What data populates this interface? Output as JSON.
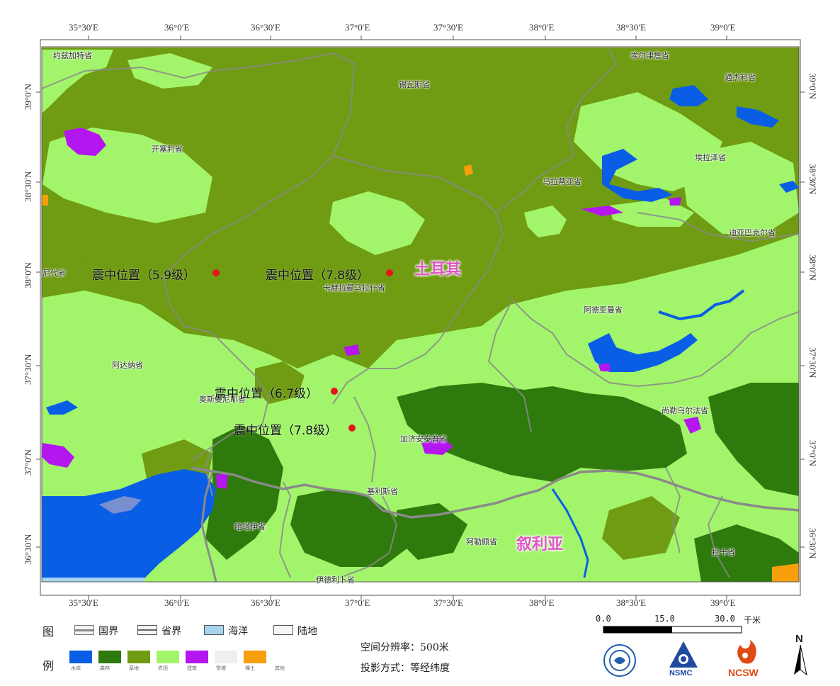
{
  "graticule": {
    "top_labels": [
      "35°30′E",
      "36°0′E",
      "36°30′E",
      "37°0′E",
      "37°30′E",
      "38°0′E",
      "38°30′E",
      "39°0′E"
    ],
    "bottom_labels": [
      "35°30′E",
      "36°0′E",
      "36°30′E",
      "37°0′E",
      "37°30′E",
      "38°0′E",
      "38°30′E",
      "39°0′E"
    ],
    "left_labels": [
      "39°0′N",
      "38°30′N",
      "38°0′N",
      "37°30′N",
      "37°0′N",
      "36°30′N"
    ],
    "right_labels": [
      "39°0′N",
      "38°30′N",
      "38°0′N",
      "37°30′N",
      "37°0′N",
      "36°30′N"
    ]
  },
  "provinces": [
    "约兹加特省",
    "锡瓦斯省",
    "埃尔津詹省",
    "通杰利省",
    "开塞利省",
    "马拉蒂亚省",
    "埃拉泽省",
    "迪亚巴克尔省",
    "尼代省",
    "卡赫拉曼马拉什省",
    "阿德亚曼省",
    "阿达纳省",
    "奥斯曼尼耶省",
    "尚勒乌尔法省",
    "加济安泰普省",
    "基利斯省",
    "哈塔伊省",
    "阿勒颇省",
    "拉卡省",
    "伊德利卜省"
  ],
  "earthquakes": [
    {
      "label": "震中位置（5.9级）"
    },
    {
      "label": "震中位置（7.8级）"
    },
    {
      "label": "震中位置（6.7级）"
    },
    {
      "label": "震中位置（7.8级）"
    }
  ],
  "countries": {
    "turkey": "土耳其",
    "syria": "叙利亚"
  },
  "legend": {
    "title_top": "图",
    "title_bottom": "例",
    "boundaries": [
      {
        "label": "国界",
        "fill": "#f4f4f4",
        "border": "#777"
      },
      {
        "label": "省界",
        "fill": "#f4f4f4",
        "border": "#555"
      },
      {
        "label": "海洋",
        "fill": "#a6d4ef",
        "border": "#555"
      },
      {
        "label": "陆地",
        "fill": "#f6f6f6",
        "border": "#555"
      }
    ],
    "classes": [
      {
        "label": "水体",
        "color": "#0a5ee6"
      },
      {
        "label": "森林",
        "color": "#2e7a0c"
      },
      {
        "label": "草地",
        "color": "#6f9c12"
      },
      {
        "label": "农田",
        "color": "#a2f56b"
      },
      {
        "label": "建筑",
        "color": "#b416f0"
      },
      {
        "label": "雪被",
        "color": "#efefef"
      },
      {
        "label": "裸土",
        "color": "#f7a00c"
      },
      {
        "label": "其他",
        "color": "#ffffff"
      }
    ]
  },
  "info": {
    "resolution": "空间分辨率：500米",
    "projection": "投影方式：等经纬度"
  },
  "scale": {
    "labels": [
      "0.0",
      "15.0",
      "30.0"
    ],
    "unit": "千米"
  },
  "north": "N",
  "logos": [
    "NSMC",
    "NCSW"
  ],
  "colors": {
    "water": "#0a5ee6",
    "forest": "#2e7a0c",
    "grass": "#6f9c12",
    "crop": "#a2f56b",
    "urban": "#b416f0",
    "bare": "#f7a00c",
    "border": "#8a8a8a",
    "epicenter": "#e8141c"
  }
}
